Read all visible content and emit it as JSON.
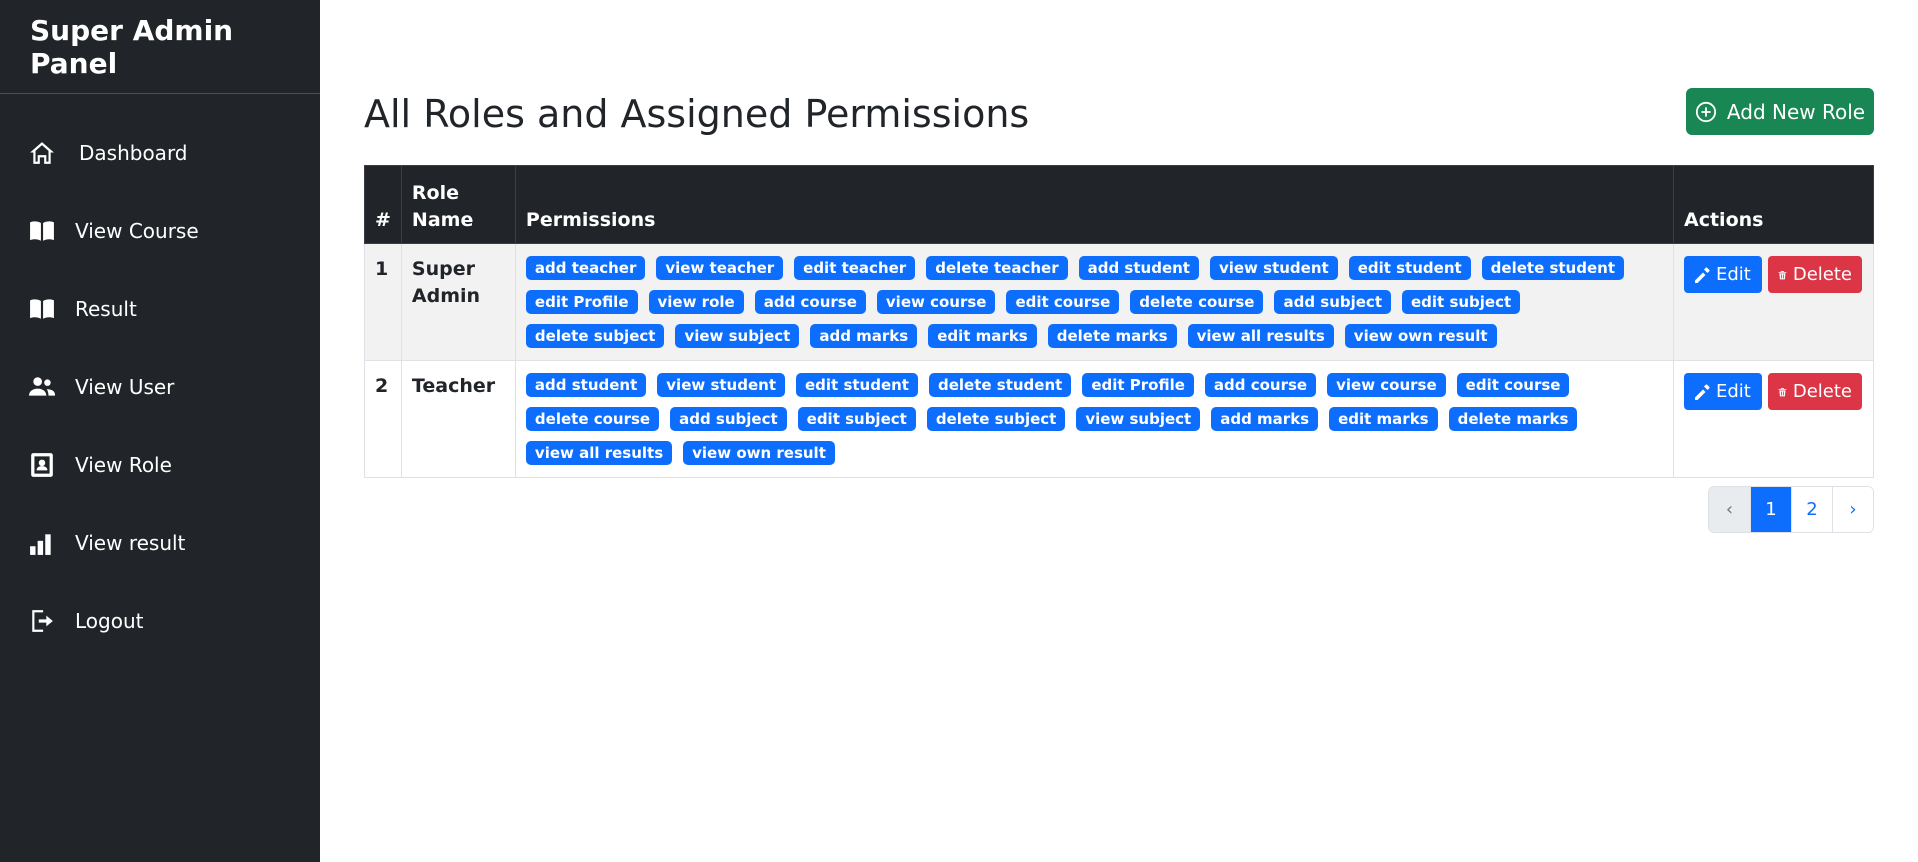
{
  "sidebar": {
    "brand": "Super Admin Panel",
    "items": [
      {
        "label": "Dashboard",
        "icon": "home-icon"
      },
      {
        "label": "View Course",
        "icon": "book-icon"
      },
      {
        "label": "Result",
        "icon": "book-icon"
      },
      {
        "label": "View User",
        "icon": "users-icon"
      },
      {
        "label": "View Role",
        "icon": "id-badge-icon"
      },
      {
        "label": "View result",
        "icon": "bar-chart-icon"
      },
      {
        "label": "Logout",
        "icon": "logout-icon"
      }
    ]
  },
  "header": {
    "title": "All Roles and Assigned Permissions",
    "add_button": "Add New Role"
  },
  "table": {
    "headers": {
      "num": "#",
      "role": "Role Name",
      "permissions": "Permissions",
      "actions": "Actions"
    },
    "rows": [
      {
        "num": "1",
        "role": "Super Admin",
        "permissions": [
          "add teacher",
          "view teacher",
          "edit teacher",
          "delete teacher",
          "add student",
          "view student",
          "edit student",
          "delete student",
          "edit Profile",
          "view role",
          "add course",
          "view course",
          "edit course",
          "delete course",
          "add subject",
          "edit subject",
          "delete subject",
          "view subject",
          "add marks",
          "edit marks",
          "delete marks",
          "view all results",
          "view own result"
        ],
        "edit_label": "Edit",
        "delete_label": "Delete"
      },
      {
        "num": "2",
        "role": "Teacher",
        "permissions": [
          "add student",
          "view student",
          "edit student",
          "delete student",
          "edit Profile",
          "add course",
          "view course",
          "edit course",
          "delete course",
          "add subject",
          "edit subject",
          "delete subject",
          "view subject",
          "add marks",
          "edit marks",
          "delete marks",
          "view all results",
          "view own result"
        ],
        "edit_label": "Edit",
        "delete_label": "Delete"
      }
    ]
  },
  "pagination": {
    "prev": "‹",
    "pages": [
      "1",
      "2"
    ],
    "next": "›",
    "active_page": "1"
  },
  "colors": {
    "sidebar_bg": "#212529",
    "primary": "#0d6efd",
    "success": "#198754",
    "danger": "#dc3545"
  }
}
